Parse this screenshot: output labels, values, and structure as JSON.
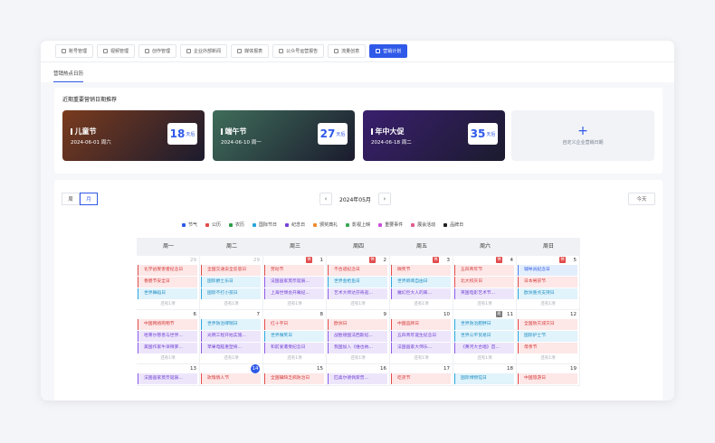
{
  "nav": {
    "tabs": [
      {
        "label": "账号管理",
        "icon": "account-icon"
      },
      {
        "label": "视频管理",
        "icon": "video-icon"
      },
      {
        "label": "创作管理",
        "icon": "create-icon"
      },
      {
        "label": "企业外部新闻",
        "icon": "news-icon"
      },
      {
        "label": "媒体报表",
        "icon": "report-icon"
      },
      {
        "label": "公众号运营报告",
        "icon": "wechat-icon"
      },
      {
        "label": "流量创意",
        "icon": "idea-icon"
      },
      {
        "label": "营销计划",
        "icon": "plan-icon",
        "active": true
      }
    ],
    "subtab": "营销热点日历"
  },
  "recommend": {
    "heading": "近期重要营销日期推荐",
    "events": [
      {
        "title": "儿童节",
        "date": "2024-06-01 周六",
        "days": "18",
        "unit": "天后",
        "color": "#7a3b1e"
      },
      {
        "title": "端午节",
        "date": "2024-06-10 周一",
        "days": "27",
        "unit": "天后",
        "color": "#3f6d5a"
      },
      {
        "title": "年中大促",
        "date": "2024-06-18 周二",
        "days": "35",
        "unit": "天后",
        "color": "#3a1f6e"
      }
    ],
    "add_label": "自定义企业营销日期",
    "add_icon": "plus-icon"
  },
  "calendar": {
    "view_week": "周",
    "view_month": "月",
    "month_label": "2024年05月",
    "today_button": "今天",
    "legend": [
      {
        "label": "节气",
        "color": "#2f59e8"
      },
      {
        "label": "公历",
        "color": "#e24a4a"
      },
      {
        "label": "农历",
        "color": "#2f9e47"
      },
      {
        "label": "国际节日",
        "color": "#2aa5dc"
      },
      {
        "label": "纪念日",
        "color": "#7343d6"
      },
      {
        "label": "颁奖典礼",
        "color": "#f08a2f"
      },
      {
        "label": "影视上映",
        "color": "#3aa955"
      },
      {
        "label": "重要事件",
        "color": "#c94fd8"
      },
      {
        "label": "展会活动",
        "color": "#e05e8f"
      },
      {
        "label": "品牌日",
        "color": "#222222"
      }
    ],
    "weekdays": [
      "周一",
      "周二",
      "周三",
      "周四",
      "周五",
      "周六",
      "周日"
    ],
    "weeks": [
      [
        {
          "day": "29",
          "dim": true,
          "events": [
            {
              "t": "化学战受害者纪念日",
              "c": "red"
            },
            {
              "t": "香肠节安全日",
              "c": "red"
            },
            {
              "t": "世界舞蹈日",
              "c": "cyan"
            }
          ],
          "more": "还有1项"
        },
        {
          "day": "29",
          "dim": true,
          "events": [
            {
              "t": "全国交通安全反思日",
              "c": "red"
            },
            {
              "t": "国际爵士乐日",
              "c": "cyan"
            },
            {
              "t": "国际不打小孩日",
              "c": "cyan"
            }
          ],
          "more": "还有1项"
        },
        {
          "day": "1",
          "badge": "休",
          "badgeType": "off",
          "events": [
            {
              "t": "劳动节",
              "c": "red"
            },
            {
              "t": "法国画家莫奈诞辰...",
              "c": "purple"
            },
            {
              "t": "上海世博会开幕纪...",
              "c": "purple"
            }
          ],
          "more": "还有1项"
        },
        {
          "day": "2",
          "badge": "休",
          "badgeType": "off",
          "events": [
            {
              "t": "不合适纪念日",
              "c": "red"
            },
            {
              "t": "世界金枪鱼日",
              "c": "cyan"
            },
            {
              "t": "艺术大师达芬奇逝...",
              "c": "purple"
            }
          ],
          "more": "还有1项"
        },
        {
          "day": "3",
          "badge": "休",
          "badgeType": "off",
          "events": [
            {
              "t": "微笑节",
              "c": "red"
            },
            {
              "t": "世界新闻自由日",
              "c": "cyan"
            },
            {
              "t": "魔幻巨大人的离...",
              "c": "purple"
            }
          ],
          "more": "还有1项"
        },
        {
          "day": "4",
          "badge": "休",
          "badgeType": "off",
          "events": [
            {
              "t": "五四青年节",
              "c": "red"
            },
            {
              "t": "北大校庆日",
              "c": "red"
            },
            {
              "t": "英国电影艺术节...",
              "c": "purple"
            }
          ],
          "more": "还有1项"
        },
        {
          "day": "5",
          "badge": "休",
          "badgeType": "off",
          "events": [
            {
              "t": "辅导员纪念日",
              "c": "blue"
            },
            {
              "t": "日本男孩节",
              "c": "red"
            },
            {
              "t": "欧洲重点支持日",
              "c": "cyan"
            }
          ],
          "more": "还有1项"
        }
      ],
      [
        {
          "day": "6",
          "events": [
            {
              "t": "中国网络购物节",
              "c": "red"
            },
            {
              "t": "哈莱尔慈善与世界...",
              "c": "purple"
            },
            {
              "t": "美国作家牛津辣萝...",
              "c": "purple"
            }
          ],
          "more": "还有1项"
        },
        {
          "day": "7",
          "events": [
            {
              "t": "世界防治哮喘日",
              "c": "cyan"
            },
            {
              "t": "光明工程开始实施...",
              "c": "purple"
            },
            {
              "t": "苹果电脑重塑将...",
              "c": "purple"
            }
          ],
          "more": "还有1项"
        },
        {
          "day": "8",
          "events": [
            {
              "t": "红十字日",
              "c": "red"
            },
            {
              "t": "世界微笑日",
              "c": "cyan"
            },
            {
              "t": "和前爱遭受纪念日",
              "c": "purple"
            }
          ],
          "more": "还有1项"
        },
        {
          "day": "9",
          "events": [
            {
              "t": "欧洲日",
              "c": "red"
            },
            {
              "t": "战胜德国法西斯纪...",
              "c": "purple"
            },
            {
              "t": "我国加入《维也纳...",
              "c": "purple"
            }
          ],
          "more": "还有1项"
        },
        {
          "day": "10",
          "events": [
            {
              "t": "中国品牌日",
              "c": "red"
            },
            {
              "t": "五四青年诞生纪念日",
              "c": "purple"
            },
            {
              "t": "法国画家大师乐...",
              "c": "purple"
            }
          ],
          "more": "还有1项"
        },
        {
          "day": "11",
          "badge": "班",
          "badgeType": "work",
          "events": [
            {
              "t": "世界防治肥胖日",
              "c": "cyan"
            },
            {
              "t": "世界公平贸易日",
              "c": "cyan"
            },
            {
              "t": "《黄河大合唱》首...",
              "c": "purple"
            }
          ],
          "more": "还有1项"
        },
        {
          "day": "12",
          "events": [
            {
              "t": "全国防灾减灾日",
              "c": "red"
            },
            {
              "t": "国际护士节",
              "c": "cyan"
            },
            {
              "t": "母亲节",
              "c": "red"
            }
          ],
          "more": "还有1项"
        }
      ],
      [
        {
          "day": "13",
          "events": [
            {
              "t": "法国画家莫奈诞辰...",
              "c": "purple"
            }
          ],
          "more": ""
        },
        {
          "day": "14",
          "today": true,
          "events": [
            {
              "t": "玫瑰情人节",
              "c": "red"
            }
          ],
          "more": ""
        },
        {
          "day": "15",
          "events": [
            {
              "t": "全国碘缺乏病防治日",
              "c": "red"
            }
          ],
          "more": ""
        },
        {
          "day": "16",
          "events": [
            {
              "t": "匹奥尔德佩索普...",
              "c": "purple"
            }
          ],
          "more": ""
        },
        {
          "day": "17",
          "events": [
            {
              "t": "吃货节",
              "c": "red"
            }
          ],
          "more": ""
        },
        {
          "day": "18",
          "events": [
            {
              "t": "国际博物馆日",
              "c": "cyan"
            }
          ],
          "more": ""
        },
        {
          "day": "19",
          "events": [
            {
              "t": "中国旅游日",
              "c": "red"
            }
          ],
          "more": ""
        }
      ]
    ]
  }
}
